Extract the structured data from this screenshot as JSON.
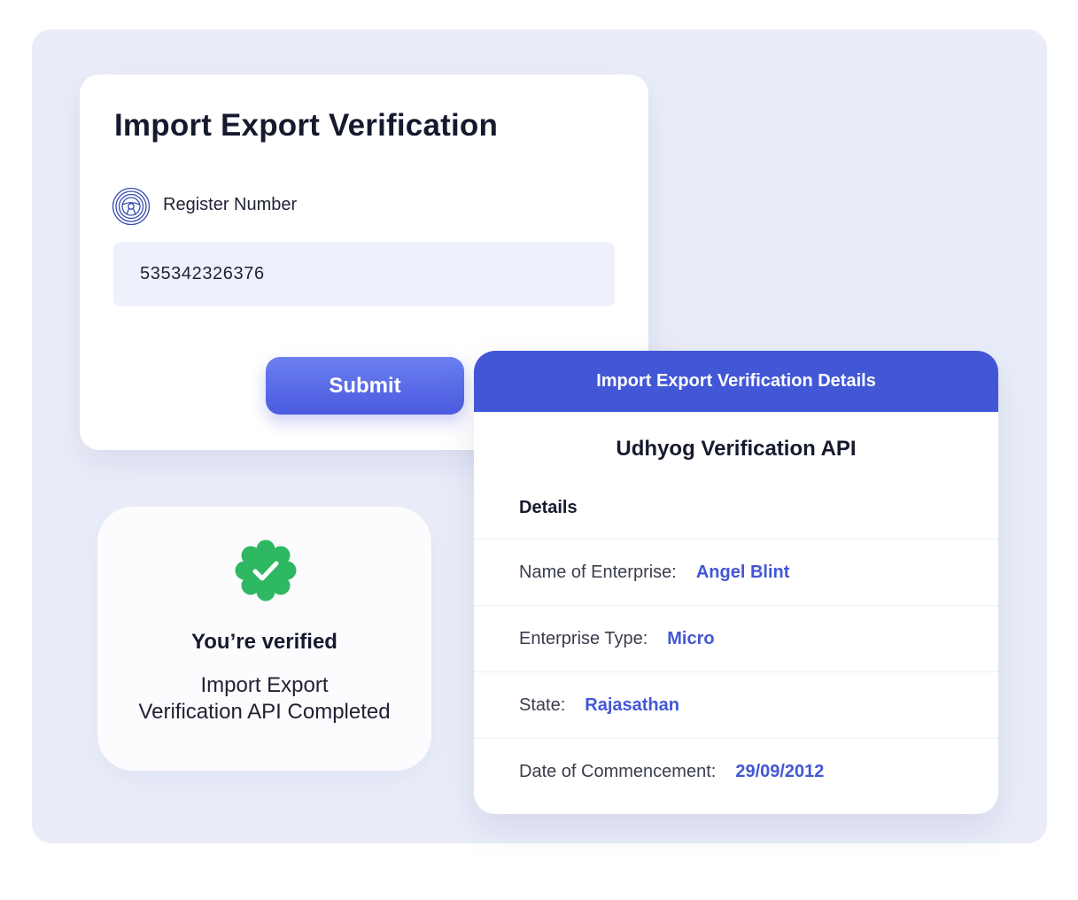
{
  "form": {
    "title": "Import Export Verification",
    "field_label": "Register Number",
    "field_value": "535342326376",
    "submit_label": "Submit"
  },
  "verified": {
    "title": "You’re verified",
    "subtitle_line1": "Import Export",
    "subtitle_line2": "Verification API Completed"
  },
  "details": {
    "header": "Import Export Verification Details",
    "api_name": "Udhyog Verification API",
    "section_label": "Details",
    "rows": [
      {
        "key": "Name of Enterprise:",
        "value": "Angel Blint"
      },
      {
        "key": "Enterprise Type:",
        "value": "Micro"
      },
      {
        "key": "State:",
        "value": "Rajasathan"
      },
      {
        "key": "Date of Commencement:",
        "value": "29/09/2012"
      }
    ]
  },
  "icons": {
    "field": "steering-wheel-icon",
    "verified": "verified-badge-icon"
  },
  "colors": {
    "accent": "#4257d6",
    "success": "#2fb862",
    "backdrop": "#eaedf9",
    "input_bg": "#eef1fb"
  }
}
